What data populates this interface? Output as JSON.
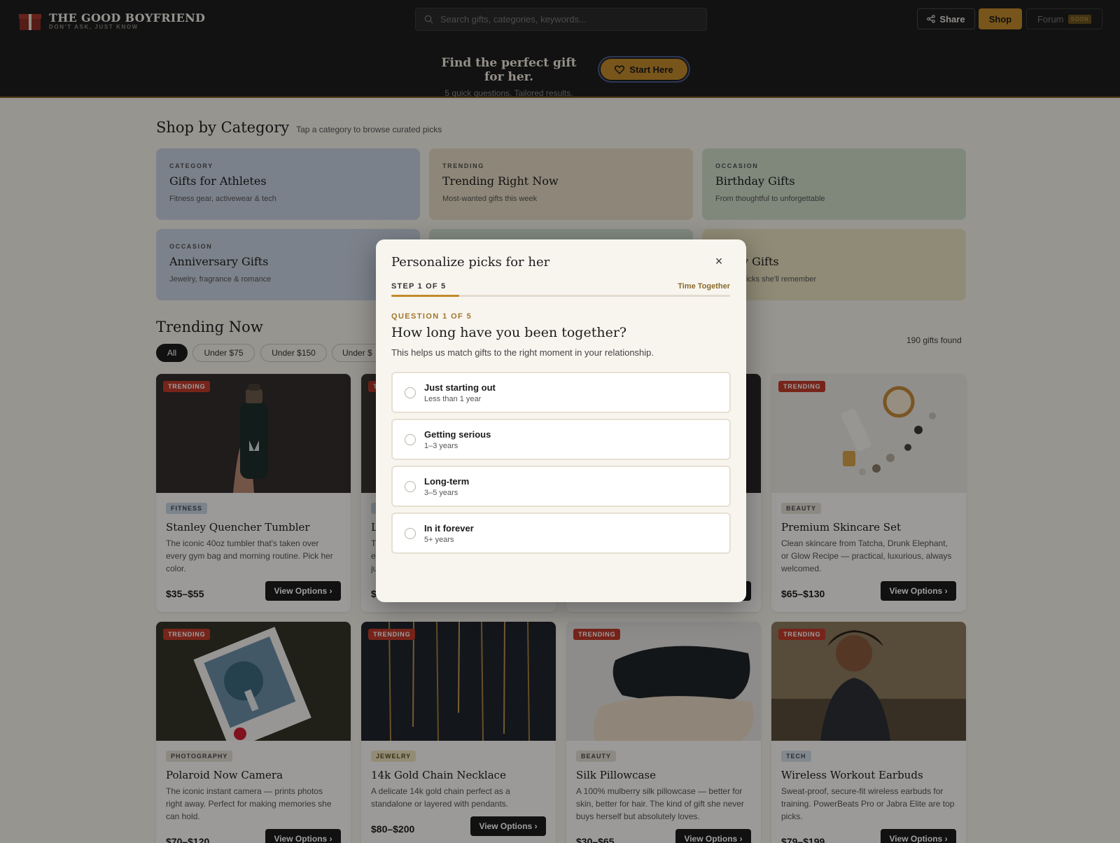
{
  "header": {
    "brand": "THE GOOD BOYFRIEND",
    "tagline": "DON'T ASK, JUST KNOW",
    "search_placeholder": "Search gifts, categories, keywords...",
    "share_label": "Share",
    "shop_label": "Shop",
    "forum_label": "Forum",
    "forum_badge": "SOON",
    "hero_title": "Find the perfect gift for her.",
    "hero_subtitle": "5 quick questions. Tailored results.",
    "start_label": "Start Here"
  },
  "categories_section": {
    "title": "Shop by Category",
    "subtitle": "Tap a category to browse curated picks",
    "items": [
      {
        "kicker": "CATEGORY",
        "name": "Gifts for Athletes",
        "desc": "Fitness gear, activewear & tech",
        "color": "#c7d1e0"
      },
      {
        "kicker": "TRENDING",
        "name": "Trending Right Now",
        "desc": "Most-wanted gifts this week",
        "color": "#e5dac3"
      },
      {
        "kicker": "OCCASION",
        "name": "Birthday Gifts",
        "desc": "From thoughtful to unforgettable",
        "color": "#cfdcc9"
      },
      {
        "kicker": "OCCASION",
        "name": "Anniversary Gifts",
        "desc": "Jewelry, fragrance & romance",
        "color": "#c9d2e0"
      },
      {
        "kicker": "",
        "name": "",
        "desc": "",
        "color": "#cfdccd"
      },
      {
        "kicker": "R",
        "name": "y Gifts",
        "desc": "picks she'll remember",
        "color": "#e8e1bf"
      }
    ]
  },
  "trending": {
    "title": "Trending Now",
    "count_label": "190 gifts found",
    "filters": [
      "All",
      "Under $75",
      "Under $150",
      "Under $"
    ],
    "products": [
      {
        "badge": "TRENDING",
        "tag": "FITNESS",
        "tag_color": "#c8d3e0",
        "title": "Stanley Quencher Tumbler",
        "desc": "The iconic 40oz tumbler that's taken over every gym bag and morning routine. Pick her color.",
        "price": "$35–$55",
        "button": "View Options ›"
      },
      {
        "badge": "T",
        "tag": "",
        "tag_color": "#c8d3e0",
        "title": "L",
        "desc": "T e ju",
        "price": "$",
        "button": ""
      },
      {
        "badge": "",
        "tag": "",
        "tag_color": "#e0dbcf",
        "title": "",
        "desc": "",
        "price": "",
        "button": ""
      },
      {
        "badge": "TRENDING",
        "tag": "BEAUTY",
        "tag_color": "#e2ddd3",
        "title": "Premium Skincare Set",
        "desc": "Clean skincare from Tatcha, Drunk Elephant, or Glow Recipe — practical, luxurious, always welcomed.",
        "price": "$65–$130",
        "button": "View Options ›"
      },
      {
        "badge": "TRENDING",
        "tag": "PHOTOGRAPHY",
        "tag_color": "#e2ddd3",
        "title": "Polaroid Now Camera",
        "desc": "The iconic instant camera — prints photos right away. Perfect for making memories she can hold.",
        "price": "$70–$120",
        "button": "View Options ›"
      },
      {
        "badge": "TRENDING",
        "tag": "JEWELRY",
        "tag_color": "#ece3bf",
        "title": "14k Gold Chain Necklace",
        "desc": "A delicate 14k gold chain perfect as a standalone or layered with pendants.",
        "price": "$80–$200",
        "button": "View Options ›"
      },
      {
        "badge": "TRENDING",
        "tag": "BEAUTY",
        "tag_color": "#e2ddd3",
        "title": "Silk Pillowcase",
        "desc": "A 100% mulberry silk pillowcase — better for skin, better for hair. The kind of gift she never buys herself but absolutely loves.",
        "price": "$30–$65",
        "button": "View Options ›"
      },
      {
        "badge": "TRENDING",
        "tag": "TECH",
        "tag_color": "#d3dbe5",
        "title": "Wireless Workout Earbuds",
        "desc": "Sweat-proof, secure-fit wireless earbuds for training. PowerBeats Pro or Jabra Elite are top picks.",
        "price": "$79–$199",
        "button": "View Options ›"
      }
    ]
  },
  "modal": {
    "title": "Personalize picks for her",
    "close_label": "×",
    "step_label": "STEP 1 OF 5",
    "step_name": "Time Together",
    "progress": 0.2,
    "question_number": "QUESTION 1 OF 5",
    "question": "How long have you been together?",
    "help": "This helps us match gifts to the right moment in your relationship.",
    "options": [
      {
        "label": "Just starting out",
        "sub": "Less than 1 year"
      },
      {
        "label": "Getting serious",
        "sub": "1–3 years"
      },
      {
        "label": "Long-term",
        "sub": "3–5 years"
      },
      {
        "label": "In it forever",
        "sub": "5+ years"
      }
    ]
  },
  "colors": {
    "accent": "#c28a2a",
    "trending_badge": "#c13a2a",
    "header_bg": "#1d1d1f"
  },
  "icons": [
    "gift-icon",
    "search-icon",
    "share-icon",
    "heart-icon",
    "close-icon"
  ]
}
